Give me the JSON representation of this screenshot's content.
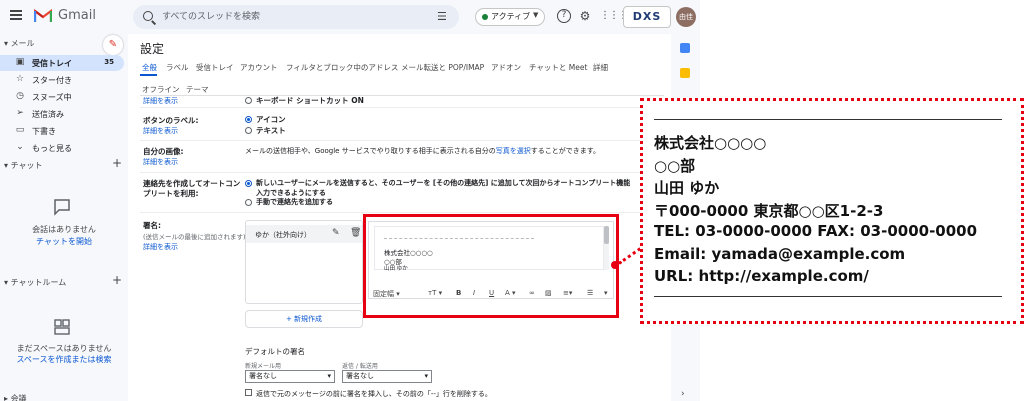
{
  "header": {
    "app_name": "Gmail",
    "search_placeholder": "すべてのスレッドを検索",
    "status": "アクティブ",
    "brand": "DXS",
    "avatar_text": "由佳"
  },
  "sidebar": {
    "mail_heading": "メール",
    "items": [
      {
        "label": "受信トレイ",
        "count": "35",
        "icon": "inbox-icon"
      },
      {
        "label": "スター付き",
        "icon": "star-icon"
      },
      {
        "label": "スヌーズ中",
        "icon": "clock-icon"
      },
      {
        "label": "送信済み",
        "icon": "send-icon"
      },
      {
        "label": "下書き",
        "icon": "draft-icon"
      },
      {
        "label": "もっと見る",
        "icon": "chevron-down-icon"
      }
    ],
    "chat_heading": "チャット",
    "chat_empty": "会話はありません",
    "chat_start": "チャットを開始",
    "rooms_heading": "チャットルーム",
    "rooms_empty": "まだスペースはありません",
    "rooms_action": "スペースを作成または検索",
    "meet_heading": "会議"
  },
  "settings": {
    "title": "設定",
    "tabs": [
      "全般",
      "ラベル",
      "受信トレイ",
      "アカウント",
      "フィルタとブロック中のアドレス",
      "メール転送と POP/IMAP",
      "アドオン",
      "チャットと Meet",
      "詳細"
    ],
    "tabs_row2": [
      "オフライン",
      "テーマ"
    ],
    "cut_link": "詳細を表示",
    "cut_option": "キーボード ショートカット ON",
    "button_labels": {
      "label": "ボタンのラベル:",
      "detail": "詳細を表示",
      "options": [
        "アイコン",
        "テキスト"
      ]
    },
    "my_picture": {
      "label": "自分の画像:",
      "detail": "詳細を表示",
      "text": "メールの送信相手や、Google サービスでやり取りする相手に表示される自分の",
      "link": "写真を選択",
      "text_end": "することができます。"
    },
    "autocomplete": {
      "label_1": "連絡先を作成してオートコン",
      "label_2": "プリートを利用:",
      "option1_line1": "新しいユーザーにメールを送信すると、そのユーザーを [その他の連絡先] に追加して次回からオートコンプリート機能",
      "option1_line2": "入力できるようにする",
      "option2": "手動で連絡先を追加する"
    },
    "signature": {
      "label": "署名:",
      "note": "(送信メールの最後に追加されます)",
      "detail": "詳細を表示",
      "item": "ゆか（社外向け）",
      "new_button": "新規作成",
      "editor_lines": [
        "株式会社○○○○",
        "○○部",
        "山田 ゆか"
      ],
      "toolbar": {
        "font": "固定幅",
        "size": "тT",
        "bold": "B",
        "italic": "I",
        "underline": "U",
        "color": "A"
      }
    },
    "defaults": {
      "heading": "デフォルトの署名",
      "new_mail_label": "新規メール用",
      "reply_label": "返信 / 転送用",
      "new_mail_value": "署名なし",
      "reply_value": "署名なし",
      "insert_note": "返信で元のメッセージの前に署名を挿入し、その前の「--」行を削除する。"
    }
  },
  "callout": {
    "lines": [
      "株式会社○○○○",
      "○○部",
      "山田 ゆか",
      "〒000-0000 東京都○○区1-2-3",
      "TEL: 03-0000-0000 FAX: 03-0000-0000",
      "Email: yamada@example.com",
      "URL: http://example.com/"
    ]
  },
  "colors": {
    "accent": "#0b57d0",
    "highlight": "#e60012",
    "active_nav": "#d3e3fd"
  }
}
